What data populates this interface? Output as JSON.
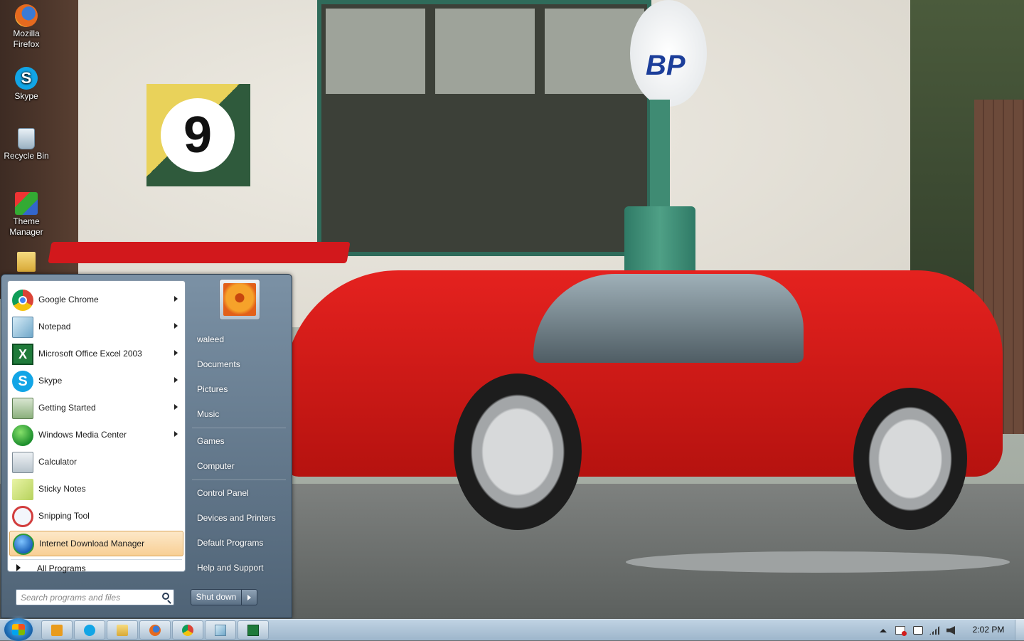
{
  "desktop": {
    "icons": [
      {
        "label": "Mozilla Firefox",
        "icon": "firefox-icon"
      },
      {
        "label": "Skype",
        "icon": "skype-icon"
      },
      {
        "label": "Recycle Bin",
        "icon": "recycle-bin-icon"
      },
      {
        "label": "Theme Manager",
        "icon": "theme-manager-icon"
      },
      {
        "label": "",
        "icon": "folder-icon"
      }
    ],
    "wallpaper": {
      "sign_number": "9",
      "pump_brand": "BP"
    }
  },
  "start_menu": {
    "pinned_programs": [
      {
        "label": "Google Chrome",
        "icon": "chrome-icon",
        "has_submenu": true
      },
      {
        "label": "Notepad",
        "icon": "notepad-icon",
        "has_submenu": true
      },
      {
        "label": "Microsoft Office Excel 2003",
        "icon": "excel-icon",
        "has_submenu": true
      },
      {
        "label": "Skype",
        "icon": "skype-icon",
        "has_submenu": true
      },
      {
        "label": "Getting Started",
        "icon": "getting-started-icon",
        "has_submenu": true
      },
      {
        "label": "Windows Media Center",
        "icon": "media-center-icon",
        "has_submenu": true
      },
      {
        "label": "Calculator",
        "icon": "calculator-icon",
        "has_submenu": false
      },
      {
        "label": "Sticky Notes",
        "icon": "sticky-notes-icon",
        "has_submenu": false
      },
      {
        "label": "Snipping Tool",
        "icon": "snipping-tool-icon",
        "has_submenu": false
      },
      {
        "label": "Internet Download Manager",
        "icon": "idm-icon",
        "has_submenu": false,
        "highlighted": true
      }
    ],
    "all_programs_label": "All Programs",
    "search_placeholder": "Search programs and files",
    "user_name": "waleed",
    "right_links": [
      "Documents",
      "Pictures",
      "Music",
      "Games",
      "Computer",
      "Control Panel",
      "Devices and Printers",
      "Default Programs",
      "Help and Support"
    ],
    "shutdown_label": "Shut down"
  },
  "taskbar": {
    "pinned": [
      "media-player-icon",
      "skype-icon",
      "explorer-icon",
      "firefox-icon",
      "chrome-icon",
      "notepad-icon",
      "excel-icon"
    ],
    "tray_icons": [
      "show-hidden-icons",
      "action-center-icon",
      "idm-tray-icon",
      "network-icon",
      "volume-icon"
    ],
    "clock": "2:02 PM"
  },
  "colors": {
    "highlight": "#f8cf95",
    "taskbar": "#b2c8db",
    "start_menu_right": "#5f7488"
  }
}
